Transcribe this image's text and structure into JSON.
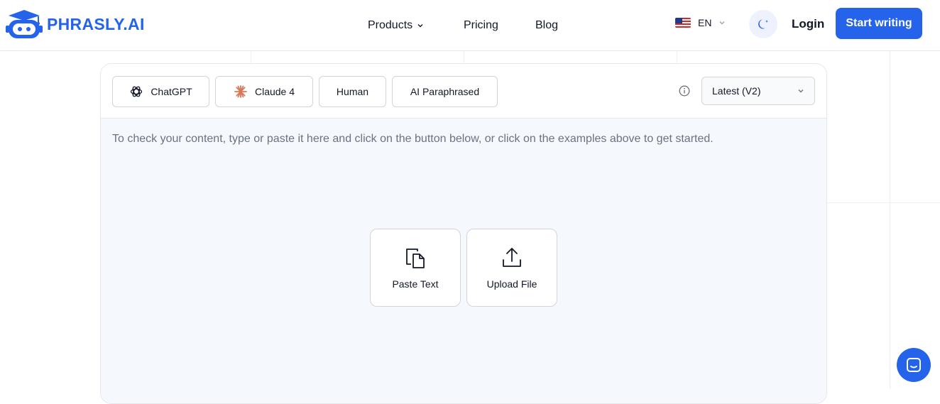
{
  "brand": {
    "name": "PHRASLY.AI",
    "accent": "#2563eb"
  },
  "nav": {
    "products": "Products",
    "pricing": "Pricing",
    "blog": "Blog"
  },
  "language": {
    "code": "EN",
    "flag": "us-flag-icon"
  },
  "header": {
    "login": "Login",
    "start_writing": "Start writing"
  },
  "samples": [
    {
      "label": "ChatGPT",
      "icon": "openai-icon"
    },
    {
      "label": "Claude 4",
      "icon": "claude-icon"
    },
    {
      "label": "Human"
    },
    {
      "label": "AI Paraphrased"
    }
  ],
  "version": {
    "selected": "Latest (V2)"
  },
  "editor": {
    "placeholder": "To check your content, type or paste it here and click on the button below, or click on the examples above to get started.",
    "paste_label": "Paste Text",
    "upload_label": "Upload File"
  }
}
